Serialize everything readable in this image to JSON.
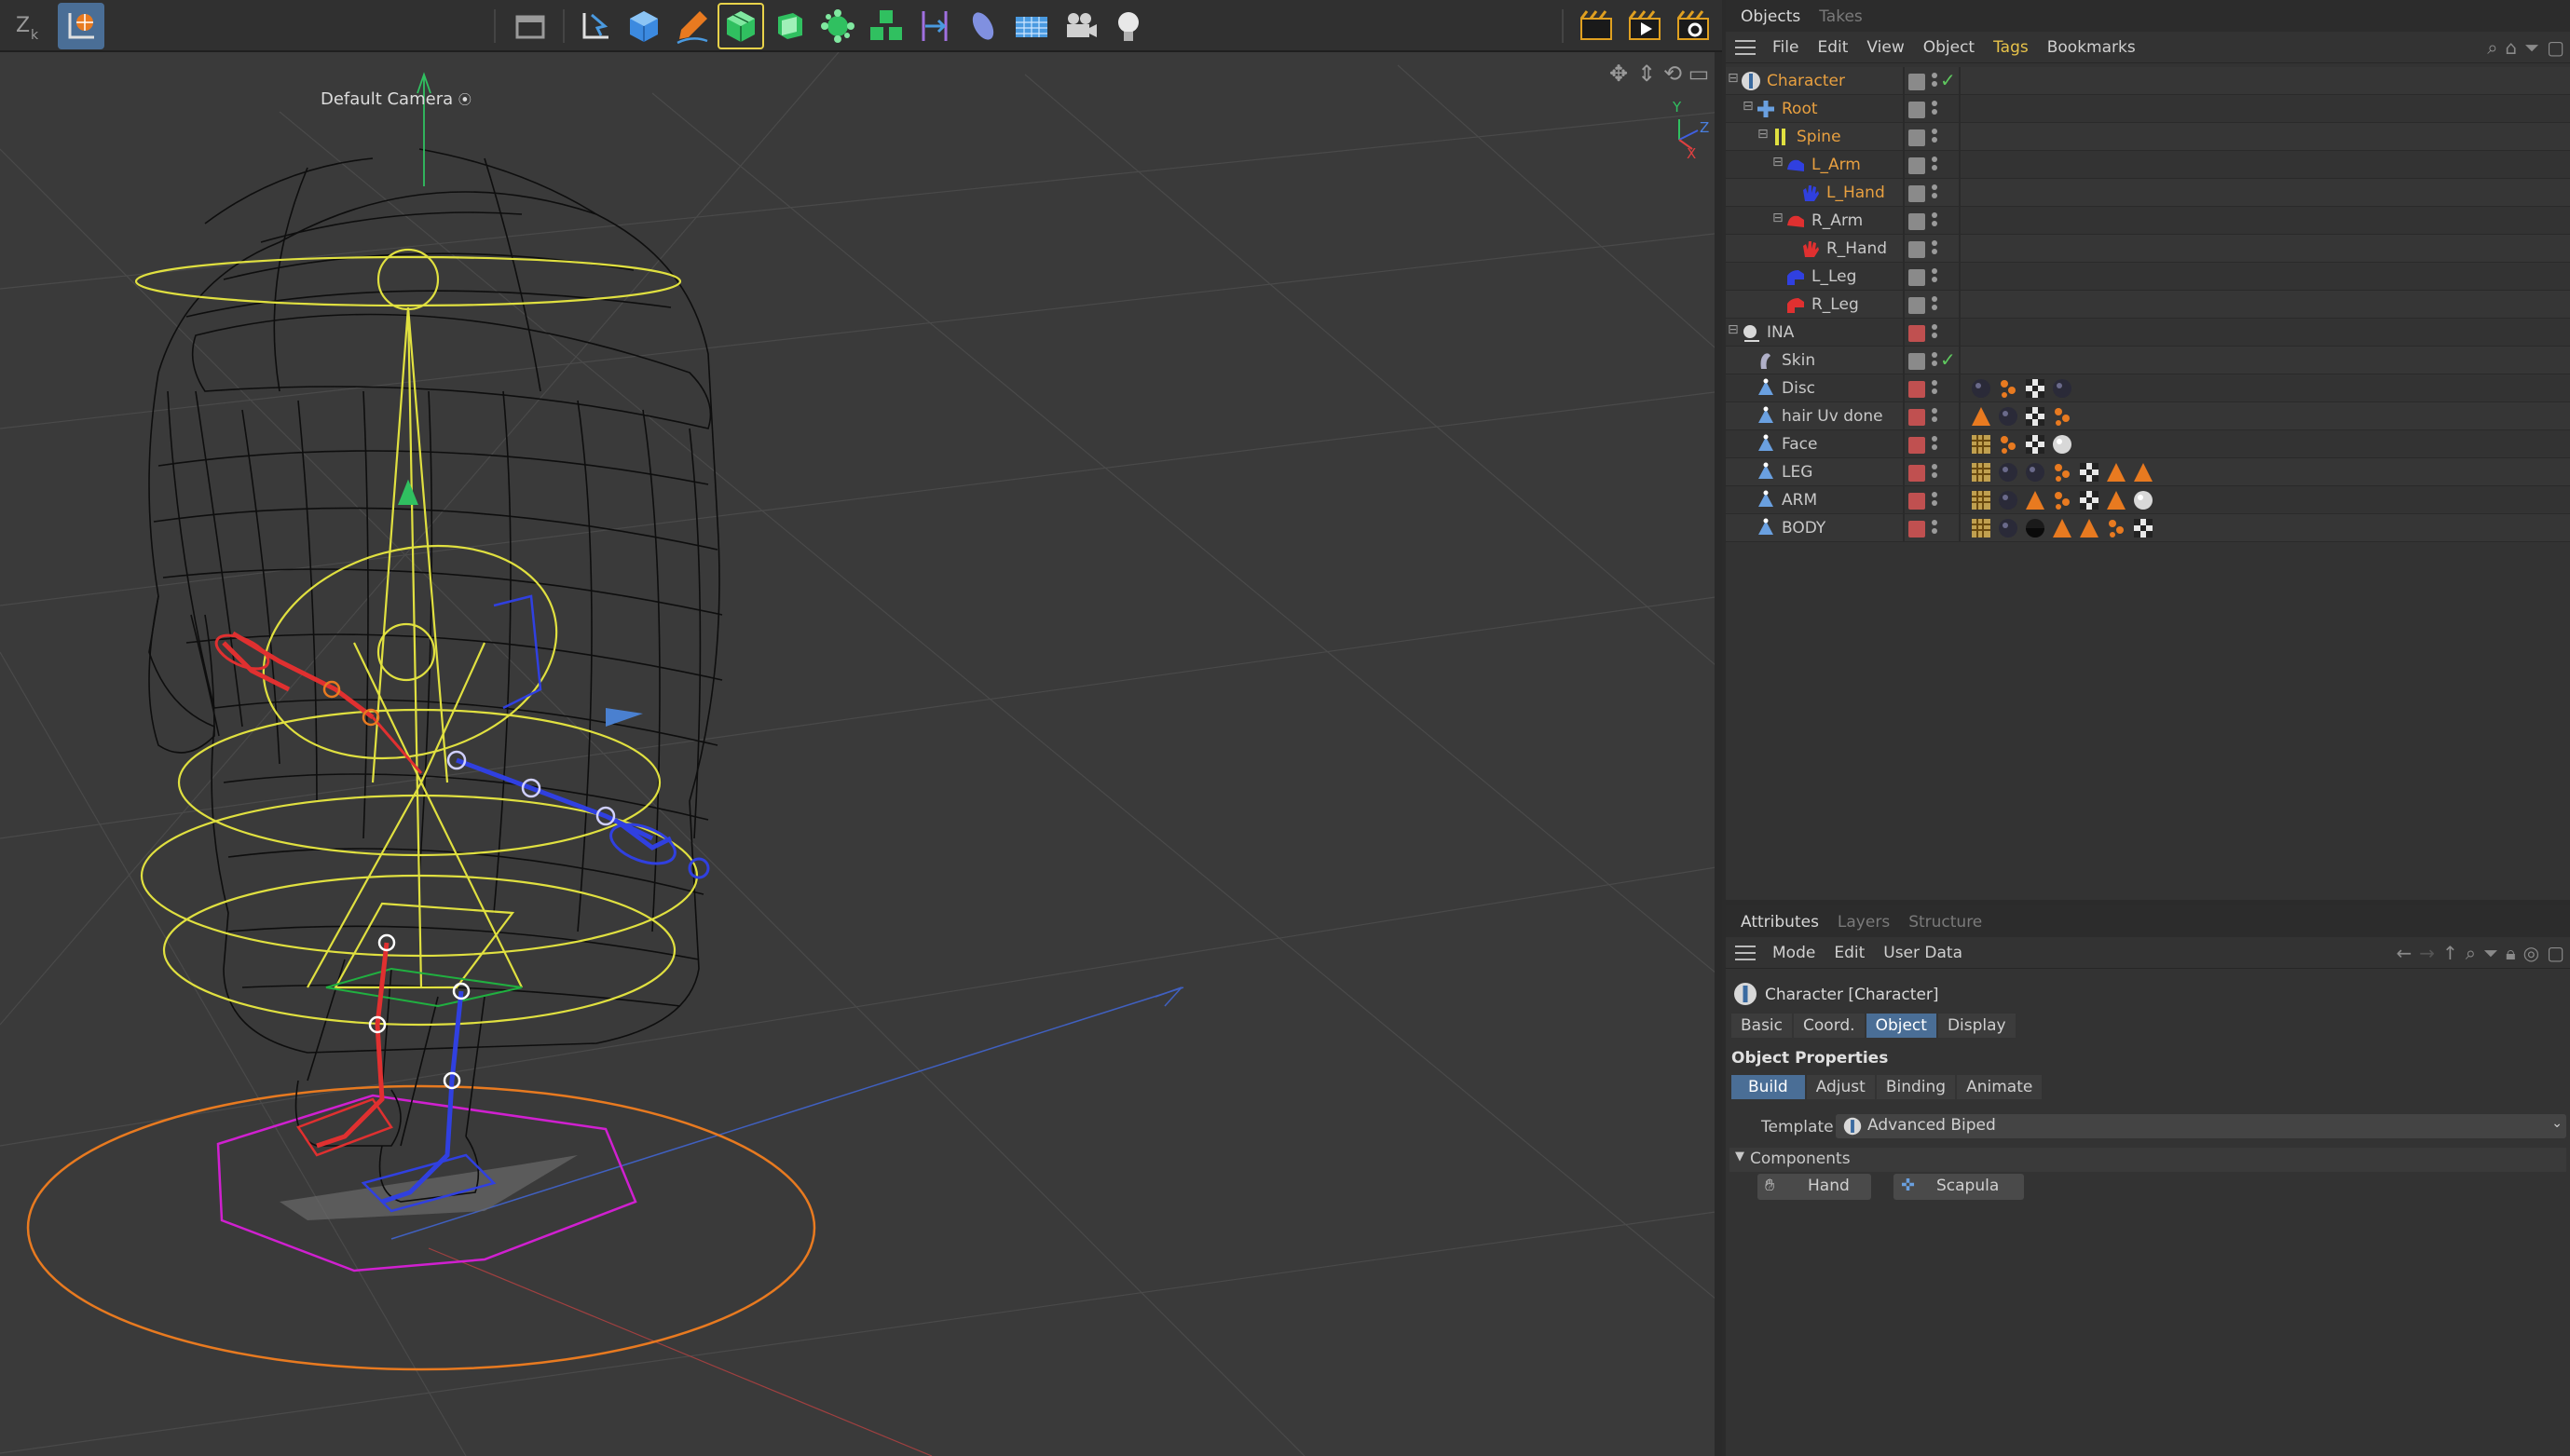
{
  "toolbar": {
    "left_icons": [
      "axis-lock-icon",
      "world-coordinates-icon"
    ],
    "center_icons": [
      "undo-view-icon",
      "select-tool-icon",
      "cube-icon",
      "pen-icon",
      "subdivision-icon",
      "extrude-icon",
      "deformer-icon",
      "cloner-icon",
      "field-icon",
      "spline-icon",
      "floor-icon",
      "camera-icon",
      "light-icon"
    ],
    "right_icons": [
      "render-region-icon",
      "render-view-icon",
      "render-settings-icon"
    ]
  },
  "viewport": {
    "camera_label": "Default Camera",
    "axis_labels": {
      "y": "Y",
      "z": "Z",
      "x": "X"
    }
  },
  "objects_panel": {
    "tabs": [
      "Objects",
      "Takes"
    ],
    "active_tab": "Objects",
    "menu": [
      "File",
      "Edit",
      "View",
      "Object",
      "Tags",
      "Bookmarks"
    ],
    "highlighted_menu": "Tags",
    "items": [
      {
        "name": "Character",
        "color": "#e8a040",
        "indent": 0,
        "icon": "character-icon",
        "vis": "edit",
        "check": true,
        "tags": []
      },
      {
        "name": "Root",
        "color": "#e8a040",
        "indent": 1,
        "icon": "joint-root-icon",
        "vis": "edit",
        "check": false,
        "tags": []
      },
      {
        "name": "Spine",
        "color": "#e8a040",
        "indent": 2,
        "icon": "spine-icon",
        "vis": "edit",
        "check": false,
        "tags": []
      },
      {
        "name": "L_Arm",
        "color": "#e8a040",
        "indent": 3,
        "icon": "arm-blue-icon",
        "vis": "edit",
        "check": false,
        "tags": []
      },
      {
        "name": "L_Hand",
        "color": "#e8a040",
        "indent": 4,
        "icon": "hand-blue-icon",
        "vis": "edit",
        "check": false,
        "tags": []
      },
      {
        "name": "R_Arm",
        "color": "#c8c8c8",
        "indent": 3,
        "icon": "arm-red-icon",
        "vis": "edit",
        "check": false,
        "tags": []
      },
      {
        "name": "R_Hand",
        "color": "#c8c8c8",
        "indent": 4,
        "icon": "hand-red-icon",
        "vis": "edit",
        "check": false,
        "tags": []
      },
      {
        "name": "L_Leg",
        "color": "#c8c8c8",
        "indent": 3,
        "icon": "leg-blue-icon",
        "vis": "edit",
        "check": false,
        "tags": []
      },
      {
        "name": "R_Leg",
        "color": "#c8c8c8",
        "indent": 3,
        "icon": "leg-red-icon",
        "vis": "edit",
        "check": false,
        "tags": []
      },
      {
        "name": "INA",
        "color": "#c8c8c8",
        "indent": 0,
        "icon": "null-object-icon",
        "vis": "red",
        "check": false,
        "tags": []
      },
      {
        "name": "Skin",
        "color": "#c8c8c8",
        "indent": 1,
        "icon": "skin-icon",
        "vis": "edit",
        "check": true,
        "tags": []
      },
      {
        "name": "Disc",
        "color": "#c8c8c8",
        "indent": 1,
        "icon": "polygon-object-icon",
        "vis": "red",
        "check": false,
        "tags": [
          "material",
          "vertex-map",
          "checker",
          "material"
        ]
      },
      {
        "name": "hair Uv done",
        "color": "#c8c8c8",
        "indent": 1,
        "icon": "polygon-object-icon",
        "vis": "red",
        "check": false,
        "tags": [
          "phong",
          "material",
          "checker",
          "vertex-map"
        ]
      },
      {
        "name": "Face",
        "color": "#c8c8c8",
        "indent": 1,
        "icon": "polygon-object-icon",
        "vis": "red",
        "check": false,
        "tags": [
          "weight",
          "vertex-map",
          "checker",
          "material-light"
        ]
      },
      {
        "name": "LEG",
        "color": "#c8c8c8",
        "indent": 1,
        "icon": "polygon-object-icon",
        "vis": "red",
        "check": false,
        "tags": [
          "weight",
          "material",
          "material",
          "vertex-map",
          "checker",
          "phong",
          "phong"
        ]
      },
      {
        "name": "ARM",
        "color": "#c8c8c8",
        "indent": 1,
        "icon": "polygon-object-icon",
        "vis": "red",
        "check": false,
        "tags": [
          "weight",
          "material",
          "phong",
          "vertex-map",
          "checker",
          "phong",
          "material-light"
        ]
      },
      {
        "name": "BODY",
        "color": "#c8c8c8",
        "indent": 1,
        "icon": "polygon-object-icon",
        "vis": "red",
        "check": false,
        "tags": [
          "weight",
          "material",
          "material-half",
          "phong",
          "phong",
          "vertex-map",
          "checker"
        ]
      }
    ]
  },
  "attributes_panel": {
    "tabs": [
      "Attributes",
      "Layers",
      "Structure"
    ],
    "active_tab": "Attributes",
    "menu": [
      "Mode",
      "Edit",
      "User Data"
    ],
    "object_title": "Character [Character]",
    "tabs_object": [
      "Basic",
      "Coord.",
      "Object",
      "Display"
    ],
    "active_object_tab": "Object",
    "section_title": "Object Properties",
    "build_tabs": [
      "Build",
      "Adjust",
      "Binding",
      "Animate"
    ],
    "active_build_tab": "Build",
    "template_label": "Template",
    "template_value": "Advanced Biped",
    "components_label": "Components",
    "components": [
      "Hand",
      "Scapula"
    ]
  },
  "colors": {
    "accent": "#4a6e96",
    "selected_object": "#e8a040",
    "wire_yellow": "#e0e040",
    "wire_red": "#e03030",
    "wire_blue": "#3040e0",
    "wire_orange": "#e87a20",
    "wire_magenta": "#d020d0"
  }
}
